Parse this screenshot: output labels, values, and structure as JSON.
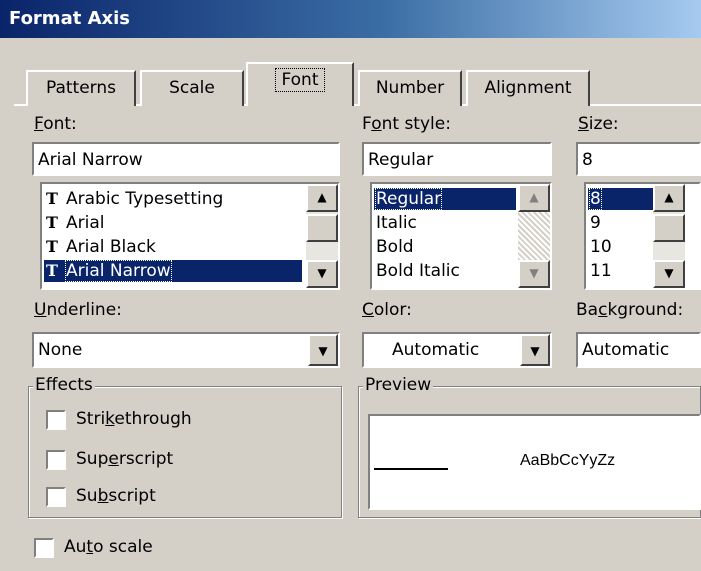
{
  "window": {
    "title": "Format Axis"
  },
  "tabs": [
    {
      "label": "Patterns"
    },
    {
      "label": "Scale"
    },
    {
      "label": "Font"
    },
    {
      "label": "Number"
    },
    {
      "label": "Alignment"
    }
  ],
  "font": {
    "label_prefix": "F",
    "label_rest": "ont:",
    "value": "Arial Narrow",
    "items": [
      "Arabic Typesetting",
      "Arial",
      "Arial Black",
      "Arial Narrow"
    ],
    "selected": "Arial Narrow",
    "icon": "truetype-icon"
  },
  "font_style": {
    "label_a": "F",
    "label_b": "o",
    "label_c": "nt style:",
    "value": "Regular",
    "items": [
      "Regular",
      "Italic",
      "Bold",
      "Bold Italic"
    ],
    "selected": "Regular"
  },
  "size": {
    "label_prefix": "S",
    "label_rest": "ize:",
    "value": "8",
    "items": [
      "8",
      "9",
      "10",
      "11"
    ],
    "selected": "8"
  },
  "underline": {
    "label_prefix": "U",
    "label_rest": "nderline:",
    "value": "None"
  },
  "color": {
    "label_prefix": "C",
    "label_rest": "olor:",
    "value": "Automatic"
  },
  "background": {
    "label_a": "Ba",
    "label_b": "c",
    "label_c": "kground:",
    "value": "Automatic"
  },
  "effects": {
    "legend": "Effects",
    "strikethrough": {
      "a": "Stri",
      "b": "k",
      "c": "ethrough",
      "checked": false
    },
    "superscript": {
      "a": "Sup",
      "b": "e",
      "c": "rscript",
      "checked": false
    },
    "subscript": {
      "a": "Su",
      "b": "b",
      "c": "script",
      "checked": false
    }
  },
  "preview": {
    "legend": "Preview",
    "sample": "AaBbCcYyZz"
  },
  "auto_scale": {
    "a": "Au",
    "b": "t",
    "c": "o scale",
    "checked": false
  },
  "colors": {
    "titlebar": "#0a246a",
    "face": "#d4d0c8",
    "selection": "#0a246a"
  }
}
